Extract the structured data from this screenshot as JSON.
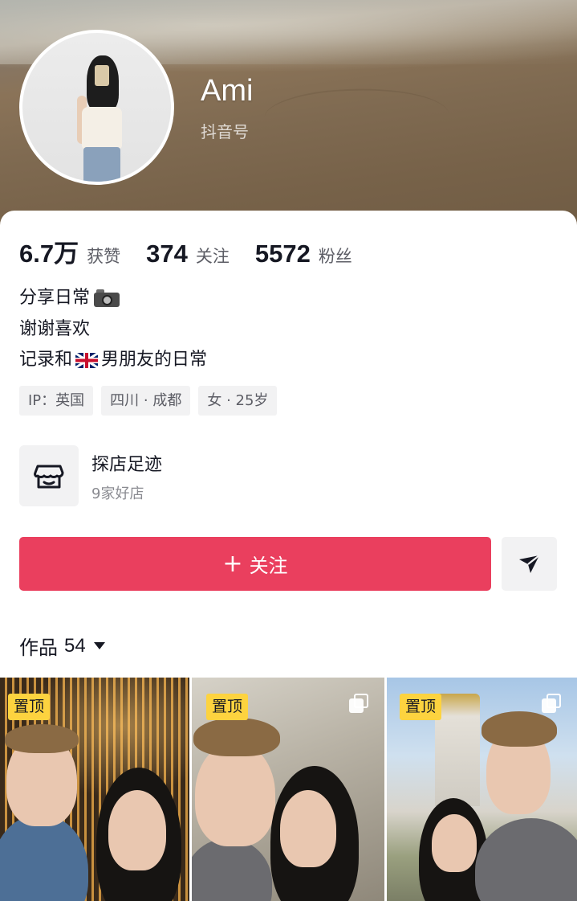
{
  "profile": {
    "name": "Ami",
    "douyin_id_label": "抖音号"
  },
  "stats": [
    {
      "value": "6.7万",
      "label": "获赞"
    },
    {
      "value": "374",
      "label": "关注"
    },
    {
      "value": "5572",
      "label": "粉丝"
    }
  ],
  "bio": {
    "line1": "分享日常",
    "line2": "谢谢喜欢",
    "line3_prefix": "记录和",
    "line3_suffix": "男朋友的日常",
    "icons": [
      "camera-icon",
      "uk-flag-icon"
    ]
  },
  "tags": [
    "IP：英国",
    "四川 · 成都",
    "女 · 25岁"
  ],
  "shop": {
    "title": "探店足迹",
    "subtitle": "9家好店",
    "icon": "shop-icon"
  },
  "actions": {
    "follow_plus": "+",
    "follow_label": "关注",
    "share_icon": "send-icon",
    "follow_color": "#ea3f5e"
  },
  "works": {
    "title": "作品",
    "count": "54"
  },
  "grid": [
    {
      "badge": "置顶",
      "multi": false
    },
    {
      "badge": "置顶",
      "multi": true
    },
    {
      "badge": "置顶",
      "multi": true
    }
  ],
  "colors": {
    "accent": "#ea3f5e",
    "pin_badge": "#fdd33f"
  }
}
